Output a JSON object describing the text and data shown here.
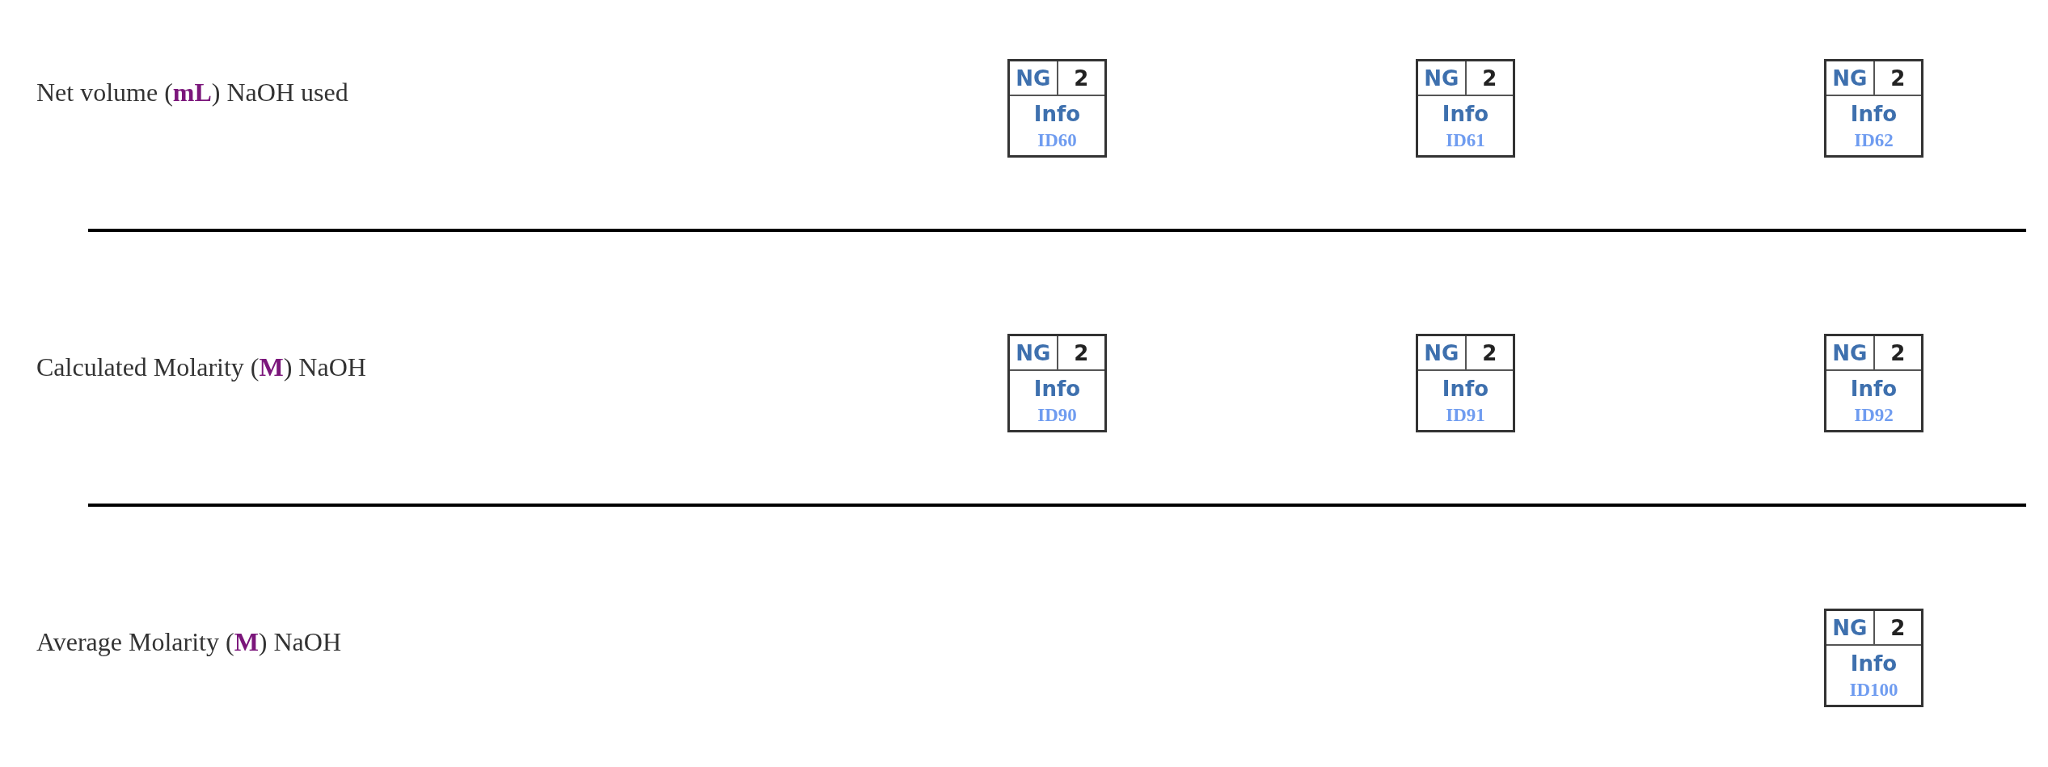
{
  "rows": [
    {
      "label": "Net volume (**mL**) NaOH used",
      "cells": [
        {
          "grade": "NG",
          "count": "2",
          "link": "Info",
          "id": "ID60"
        },
        {
          "grade": "NG",
          "count": "2",
          "link": "Info",
          "id": "ID61"
        },
        {
          "grade": "NG",
          "count": "2",
          "link": "Info",
          "id": "ID62"
        }
      ]
    },
    {
      "label": "Calculated Molarity (**M**) NaOH",
      "cells": [
        {
          "grade": "NG",
          "count": "2",
          "link": "Info",
          "id": "ID90"
        },
        {
          "grade": "NG",
          "count": "2",
          "link": "Info",
          "id": "ID91"
        },
        {
          "grade": "NG",
          "count": "2",
          "link": "Info",
          "id": "ID92"
        }
      ]
    },
    {
      "label": "Average Molarity (**M**) NaOH",
      "cells": [
        {
          "grade": "NG",
          "count": "2",
          "link": "Info",
          "id": "ID100"
        }
      ]
    }
  ]
}
